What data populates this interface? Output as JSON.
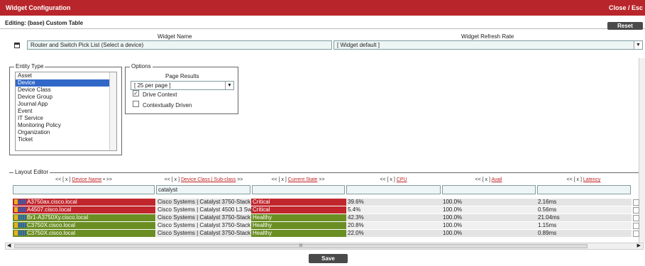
{
  "window": {
    "title": "Widget Configuration",
    "close_label": "Close / Esc"
  },
  "editing": {
    "label": "Editing: (base) Custom Table",
    "reset_label": "Reset"
  },
  "widget_name": {
    "label": "Widget Name",
    "value": "Router and Switch Pick List (Select a device)"
  },
  "refresh_rate": {
    "label": "Widget Refresh Rate",
    "value": "[ Widget default ]"
  },
  "entity_type": {
    "legend": "Entity Type",
    "items": [
      "Asset",
      "Device",
      "Device Class",
      "Device Group",
      "Journal App",
      "Event",
      "IT Service",
      "Monitoring Policy",
      "Organization",
      "Ticket"
    ],
    "selected": "Device"
  },
  "options": {
    "legend": "Options",
    "page_results_label": "Page Results",
    "page_results_value": "[ 25 per page ]",
    "drive_context_label": "Drive Context",
    "drive_context_checked": true,
    "contextually_driven_label": "Contextually Driven",
    "contextually_driven_checked": false
  },
  "layout_editor": {
    "legend": "Layout Editor",
    "columns": [
      {
        "prefix": "<< [ x ] ",
        "link": "Device Name",
        "suffix": " • >>"
      },
      {
        "prefix": "<< [ x ] ",
        "link": "Device Class | Sub-class",
        "suffix": " >>"
      },
      {
        "prefix": "<< [ x ] ",
        "link": "Current State",
        "suffix": " >>"
      },
      {
        "prefix": "<< [ x ] ",
        "link": "CPU",
        "suffix": ""
      },
      {
        "prefix": "<< [ x ] ",
        "link": "Avail",
        "suffix": ""
      },
      {
        "prefix": "<< [ x ] ",
        "link": "Latency",
        "suffix": ""
      }
    ],
    "filters": [
      "",
      "catalyst",
      "",
      "",
      "",
      ""
    ],
    "rows": [
      {
        "name": "A3750ax.cisco.local",
        "class": "Cisco Systems | Catalyst 3750-Stack",
        "state": "Critical",
        "cpu": "39.6%",
        "avail": "100.0%",
        "latency": "2.16ms"
      },
      {
        "name": "A4507.cisco.local",
        "class": "Cisco Systems | Catalyst 4500 L3 Sw",
        "state": "Critical",
        "cpu": "5.4%",
        "avail": "100.0%",
        "latency": "0.56ms"
      },
      {
        "name": "Br1-A3750Xy.cisco.local",
        "class": "Cisco Systems | Catalyst 3750-Stack",
        "state": "Healthy",
        "cpu": "42.3%",
        "avail": "100.0%",
        "latency": "21.04ms"
      },
      {
        "name": "C3750X.cisco.local",
        "class": "Cisco Systems | Catalyst 3750-Stack",
        "state": "Healthy",
        "cpu": "20.8%",
        "avail": "100.0%",
        "latency": "1.15ms"
      },
      {
        "name": "C3750X.cisco.local",
        "class": "Cisco Systems | Catalyst 3750-Stack",
        "state": "Healthy",
        "cpu": "22.0%",
        "avail": "100.0%",
        "latency": "0.89ms"
      }
    ]
  },
  "hscroll": {
    "thumb_glyph": "III"
  },
  "save_label": "Save",
  "colors": {
    "title_red": "#b8262b",
    "critical": "#c0262c",
    "healthy": "#6b8e23",
    "row_gray_a": "#e4e4e4",
    "row_gray_b": "#f0f0f0",
    "selection_blue": "#3168c8"
  }
}
